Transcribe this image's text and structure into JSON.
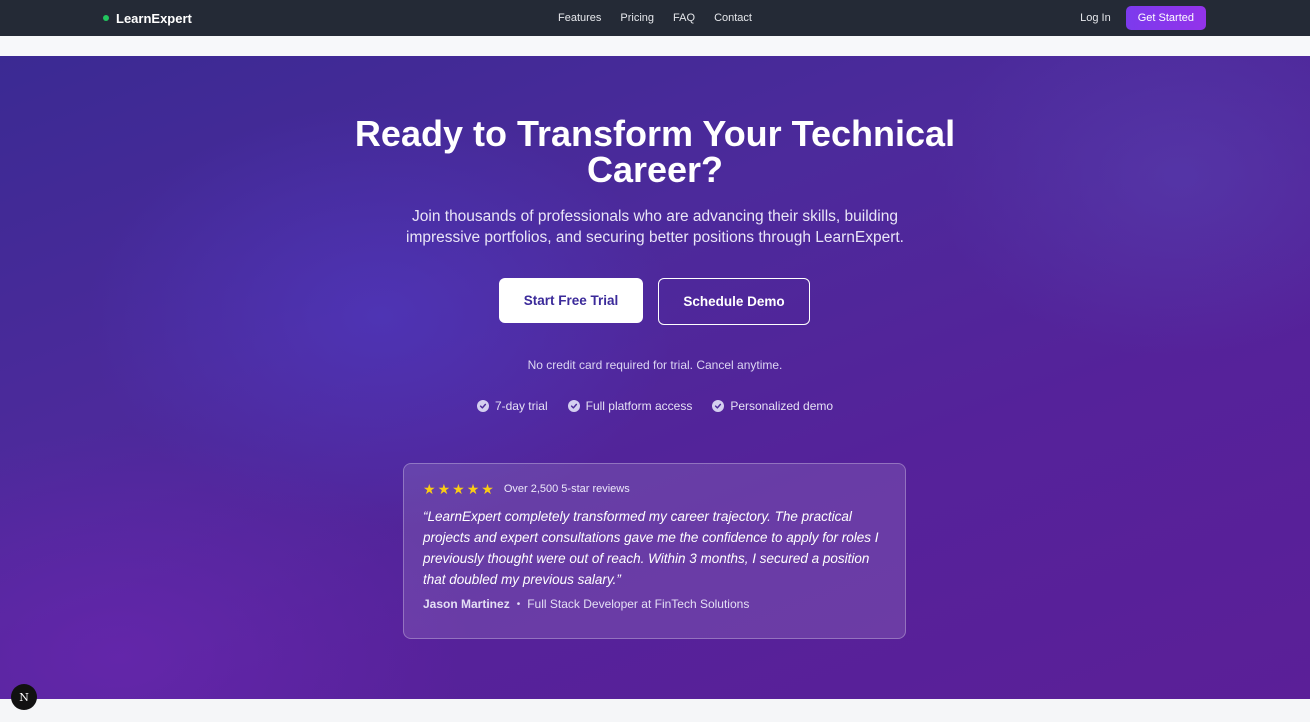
{
  "nav": {
    "brand": "LearnExpert",
    "links": [
      "Features",
      "Pricing",
      "FAQ",
      "Contact"
    ],
    "login": "Log In",
    "cta": "Get Started"
  },
  "hero": {
    "title": "Ready to Transform Your Technical Career?",
    "subtitle": "Join thousands of professionals who are advancing their skills, building impressive portfolios, and securing better positions through LearnExpert.",
    "primary_button": "Start Free Trial",
    "secondary_button": "Schedule Demo",
    "note": "No credit card required for trial. Cancel anytime.",
    "features": [
      "7-day trial",
      "Full platform access",
      "Personalized demo"
    ]
  },
  "testimonial": {
    "stars": 5,
    "reviews": "Over 2,500 5-star reviews",
    "quote": "“LearnExpert completely transformed my career trajectory. The practical projects and expert consultations gave me the confidence to apply for roles I previously thought were out of reach. Within 3 months, I secured a position that doubled my previous salary.”",
    "author_name": "Jason Martinez",
    "author_role": "Full Stack Developer at FinTech Solutions"
  },
  "colors": {
    "nav_bg": "#242a36",
    "brand_dot": "#22c55e",
    "cta_gradient_start": "#7c3aed",
    "cta_gradient_end": "#9333ea",
    "hero_bg": "#4c2a9b",
    "star": "#facc15"
  },
  "badge": "N"
}
